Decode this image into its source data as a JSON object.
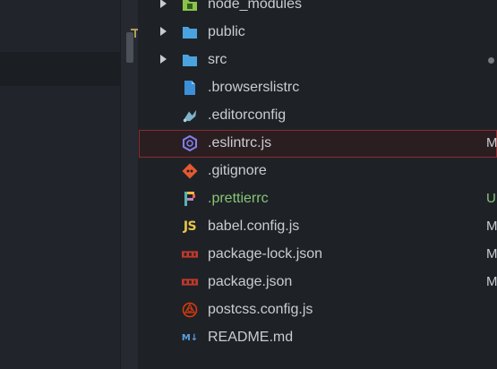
{
  "colors": {
    "folder": "#4aa3df",
    "accent_green": "#89c475",
    "selected_border": "#8b2b2f"
  },
  "tree": {
    "items": [
      {
        "name": "node_modules",
        "type": "folder",
        "icon": "node-modules-folder-icon"
      },
      {
        "name": "public",
        "type": "folder",
        "icon": "folder-icon"
      },
      {
        "name": "src",
        "type": "folder",
        "icon": "folder-icon",
        "status_dot": true
      },
      {
        "name": ".browserslistrc",
        "type": "file",
        "icon": "file-icon"
      },
      {
        "name": ".editorconfig",
        "type": "file",
        "icon": "editorconfig-icon"
      },
      {
        "name": ".eslintrc.js",
        "type": "file",
        "icon": "eslint-icon",
        "status": "M",
        "selected": true
      },
      {
        "name": ".gitignore",
        "type": "file",
        "icon": "git-icon"
      },
      {
        "name": ".prettierrc",
        "type": "file",
        "icon": "prettier-icon",
        "status": "U"
      },
      {
        "name": "babel.config.js",
        "type": "file",
        "icon": "js-icon",
        "status": "M"
      },
      {
        "name": "package-lock.json",
        "type": "file",
        "icon": "npm-icon",
        "status": "M"
      },
      {
        "name": "package.json",
        "type": "file",
        "icon": "npm-icon",
        "status": "M"
      },
      {
        "name": "postcss.config.js",
        "type": "file",
        "icon": "postcss-icon"
      },
      {
        "name": "README.md",
        "type": "file",
        "icon": "markdown-icon"
      }
    ]
  }
}
